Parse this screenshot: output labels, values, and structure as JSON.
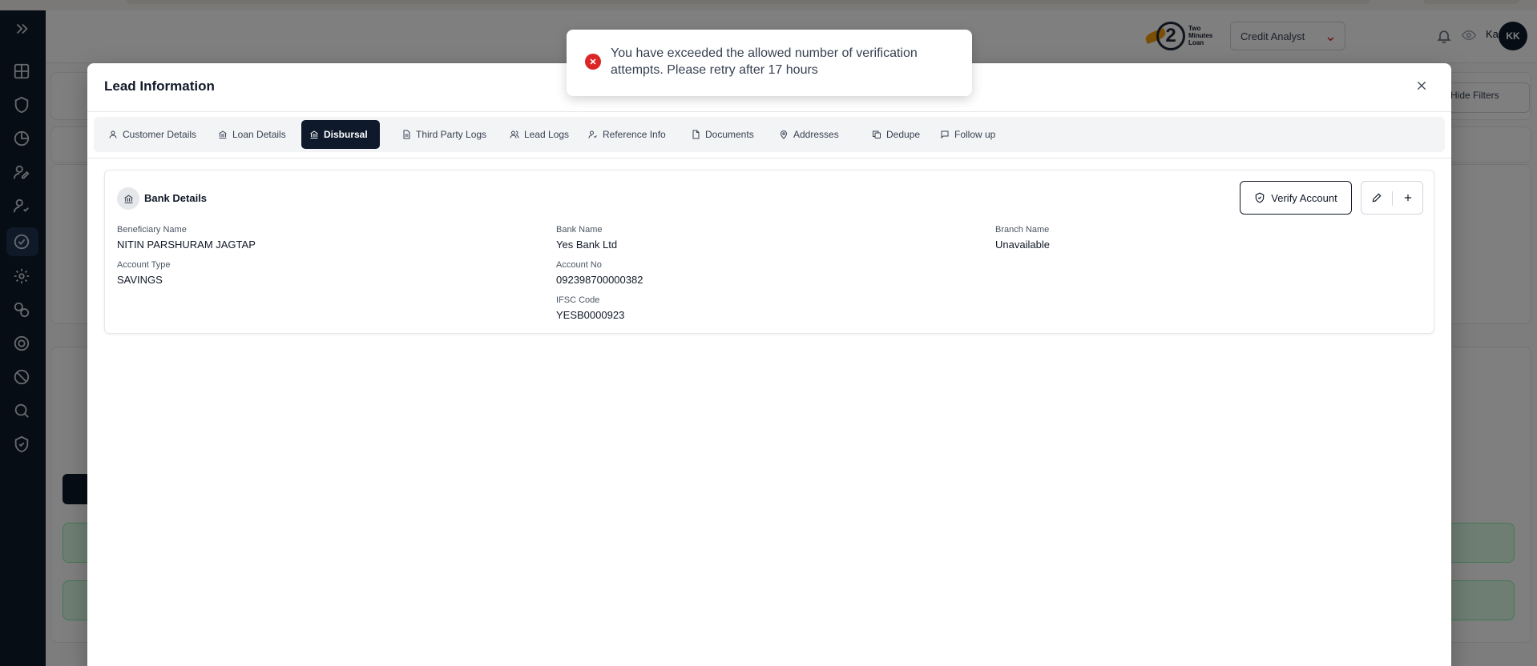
{
  "background": {
    "topbar": {
      "role_select": "Credit Analyst",
      "user_name": "Karan",
      "avatar_initials": "KK"
    },
    "buttons": {
      "hide_filters": "Hide Filters"
    }
  },
  "modal": {
    "title": "Lead Information",
    "tabs": [
      {
        "label": "Customer Details",
        "icon": "user-icon"
      },
      {
        "label": "Loan Details",
        "icon": "bank-icon"
      },
      {
        "label": "Disbursal",
        "icon": "bank-icon",
        "active": true
      },
      {
        "label": "Third Party Logs",
        "icon": "document-icon"
      },
      {
        "label": "Lead Logs",
        "icon": "users-icon"
      },
      {
        "label": "Reference Info",
        "icon": "user-check-icon"
      },
      {
        "label": "Documents",
        "icon": "file-icon"
      },
      {
        "label": "Addresses",
        "icon": "map-pin-icon"
      },
      {
        "label": "Dedupe",
        "icon": "copy-icon"
      },
      {
        "label": "Follow up",
        "icon": "message-icon"
      }
    ],
    "bank_details": {
      "heading": "Bank Details",
      "verify_button": "Verify Account",
      "fields": {
        "beneficiary_name": {
          "label": "Beneficiary Name",
          "value": "NITIN PARSHURAM JAGTAP"
        },
        "bank_name": {
          "label": "Bank Name",
          "value": "Yes Bank Ltd"
        },
        "branch_name": {
          "label": "Branch Name",
          "value": "Unavailable"
        },
        "account_type": {
          "label": "Account Type",
          "value": "SAVINGS"
        },
        "account_no": {
          "label": "Account No",
          "value": "092398700000382"
        },
        "ifsc_code": {
          "label": "IFSC Code",
          "value": "YESB0000923"
        }
      }
    }
  },
  "toast": {
    "type": "error",
    "message": "You have exceeded the allowed number of verification attempts. Please retry after 17 hours",
    "accent_color": "#dc2626"
  },
  "colors": {
    "primary_dark": "#0e1a2b",
    "error": "#dc2626"
  }
}
